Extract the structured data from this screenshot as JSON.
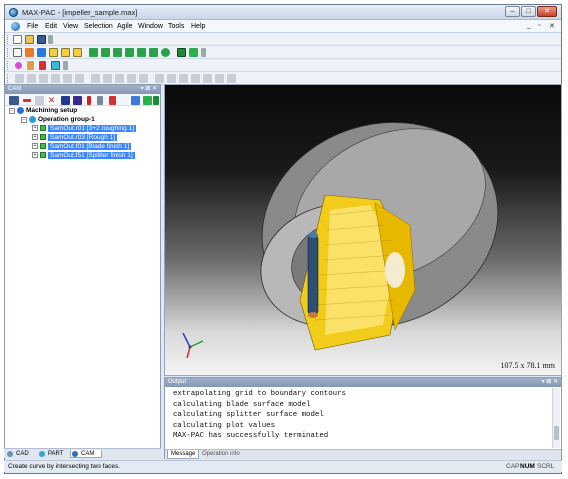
{
  "window": {
    "title": "MAX-PAC - [impeller_sample.max]",
    "controls": {
      "minimize": "–",
      "maximize": "□",
      "close": "✕"
    }
  },
  "menubar": {
    "items": [
      {
        "label": "File",
        "underline": "F"
      },
      {
        "label": "Edit",
        "underline": "E"
      },
      {
        "label": "View",
        "underline": "V"
      },
      {
        "label": "Selection",
        "underline": ""
      },
      {
        "label": "Agile",
        "underline": "A"
      },
      {
        "label": "Window",
        "underline": "W"
      },
      {
        "label": "Tools",
        "underline": ""
      },
      {
        "label": "Help",
        "underline": "H"
      }
    ],
    "mdi_controls": {
      "minimize": "_",
      "restore": "▫",
      "close": "✕"
    }
  },
  "cam_panel": {
    "title": "CAM",
    "pin": "▾ ⊠ ✕",
    "tree": {
      "root": "Machining setup",
      "group": "Operation group-1",
      "operations": [
        "SamOut.r01 [3+2 roughing 1]",
        "SamOut.r03 [Rough 1]",
        "SamOut.f01 [Blade finish 1]",
        "SamOut.f51 [Splitter finish 1]"
      ]
    }
  },
  "bottom_tabs": [
    {
      "label": "CAD",
      "icon": "cad-icon",
      "color": "#6b8fb8"
    },
    {
      "label": "PART",
      "icon": "part-icon",
      "color": "#3da0c8"
    },
    {
      "label": "CAM",
      "icon": "cam-icon",
      "color": "#2f6fb0",
      "active": true
    }
  ],
  "viewport": {
    "dimensions": "107.5 x 78.1 mm"
  },
  "output_panel": {
    "title": "Output",
    "pin": "▾ ⊠ ✕",
    "lines": [
      "extrapolating grid to boundary contours",
      "calculating blade surface model",
      "calculating splitter surface model",
      "calculating plot values",
      "MAX-PAC has successfully terminated"
    ],
    "tabs": [
      {
        "label": "Message",
        "active": true
      },
      {
        "label": "Operation info",
        "active": false
      }
    ]
  },
  "statusbar": {
    "text": "Create curve by intersecting two faces.",
    "indicators": [
      {
        "label": "CAP",
        "on": false
      },
      {
        "label": "NUM",
        "on": true
      },
      {
        "label": "SCRL",
        "on": false
      }
    ]
  },
  "colors": {
    "selection": "#3a86ff",
    "toolpath_yellow": "#ffd400",
    "tool_blue": "#2d4f73",
    "impeller_grey": "#9a9a9a"
  }
}
